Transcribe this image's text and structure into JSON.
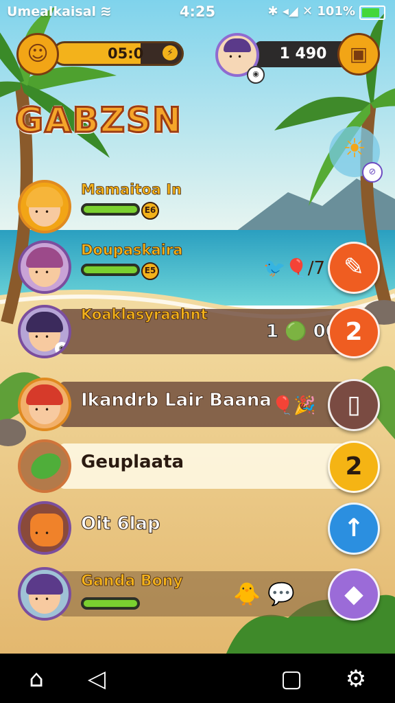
{
  "status_bar": {
    "carrier": "Umealkaisal",
    "time": "4:25",
    "right_icons": "✱ ◂◢ ✕ 101%",
    "wifi_icon": "wifi-icon",
    "battery_level": 0.9
  },
  "hud": {
    "coin_value": "05:0",
    "coin_fill": 0.68,
    "score_value": "1 490"
  },
  "title": "GABZSN",
  "rows": [
    {
      "name": "Mamaitoa In",
      "level": "E6",
      "progress": 0.95,
      "action": "",
      "action_icon": "none",
      "style": "none"
    },
    {
      "name": "Doupaskaira",
      "level": "E5",
      "progress": 0.95,
      "mid_text": "🐦🎈/7",
      "action": "✎",
      "action_icon": "pencil-icon",
      "style": "none"
    },
    {
      "name": "Koaklasyraahnt",
      "count": "1 🟢 00",
      "action": "2",
      "action_icon": "number-badge",
      "style": "dark"
    },
    {
      "name": "Ikandrb Lair Baana",
      "mid_text": "🎈🎉",
      "action": "▯",
      "action_icon": "phone-icon",
      "style": "dark"
    },
    {
      "name": "Geuplaata",
      "action": "2",
      "action_icon": "number-badge",
      "style": "light"
    },
    {
      "name": "Oit 6lap",
      "action": "↑",
      "action_icon": "arrow-up-icon",
      "style": "none"
    },
    {
      "name": "Ganda Bony",
      "progress": 0.95,
      "mid_text": "🐥 💬",
      "action": "◆",
      "action_icon": "tag-icon",
      "style": "dark"
    }
  ],
  "nav": {
    "home_icon": "home-icon",
    "back_icon": "back-icon",
    "recent_icon": "recent-apps-icon",
    "settings_icon": "settings-icon"
  }
}
